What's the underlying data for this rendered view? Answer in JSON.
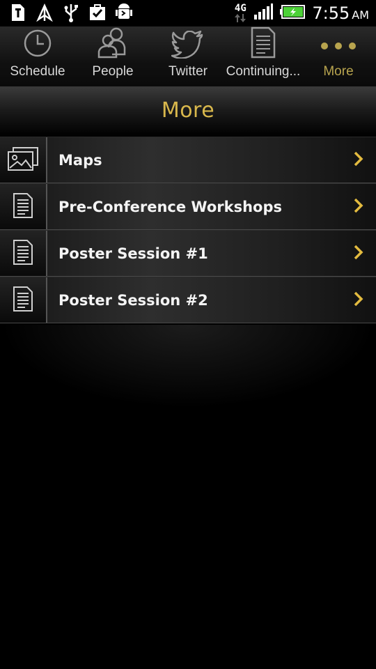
{
  "status_bar": {
    "network": "4G",
    "time": "7:55",
    "ampm": "AM",
    "left_icons": [
      "tmobile-icon",
      "wifi-hotspot-icon",
      "usb-icon",
      "task-done-icon",
      "android-debug-icon"
    ],
    "right_icons": [
      "network-4g-icon",
      "signal-icon",
      "battery-charging-icon"
    ],
    "battery_color": "#4cd137"
  },
  "tabs": [
    {
      "label": "Schedule",
      "icon": "clock-icon"
    },
    {
      "label": "People",
      "icon": "people-icon"
    },
    {
      "label": "Twitter",
      "icon": "twitter-icon"
    },
    {
      "label": "Continuing...",
      "icon": "document-icon"
    },
    {
      "label": "More",
      "icon": "more-dots-icon",
      "active": true
    }
  ],
  "header": {
    "title": "More"
  },
  "colors": {
    "accent": "#d9b84c",
    "tab_active": "#b8a44e",
    "chevron": "#e3bb3f"
  },
  "list": [
    {
      "label": "Maps",
      "icon": "image-icon"
    },
    {
      "label": "Pre-Conference Workshops",
      "icon": "document-icon"
    },
    {
      "label": "Poster Session #1",
      "icon": "document-icon"
    },
    {
      "label": "Poster Session #2",
      "icon": "document-icon"
    }
  ]
}
